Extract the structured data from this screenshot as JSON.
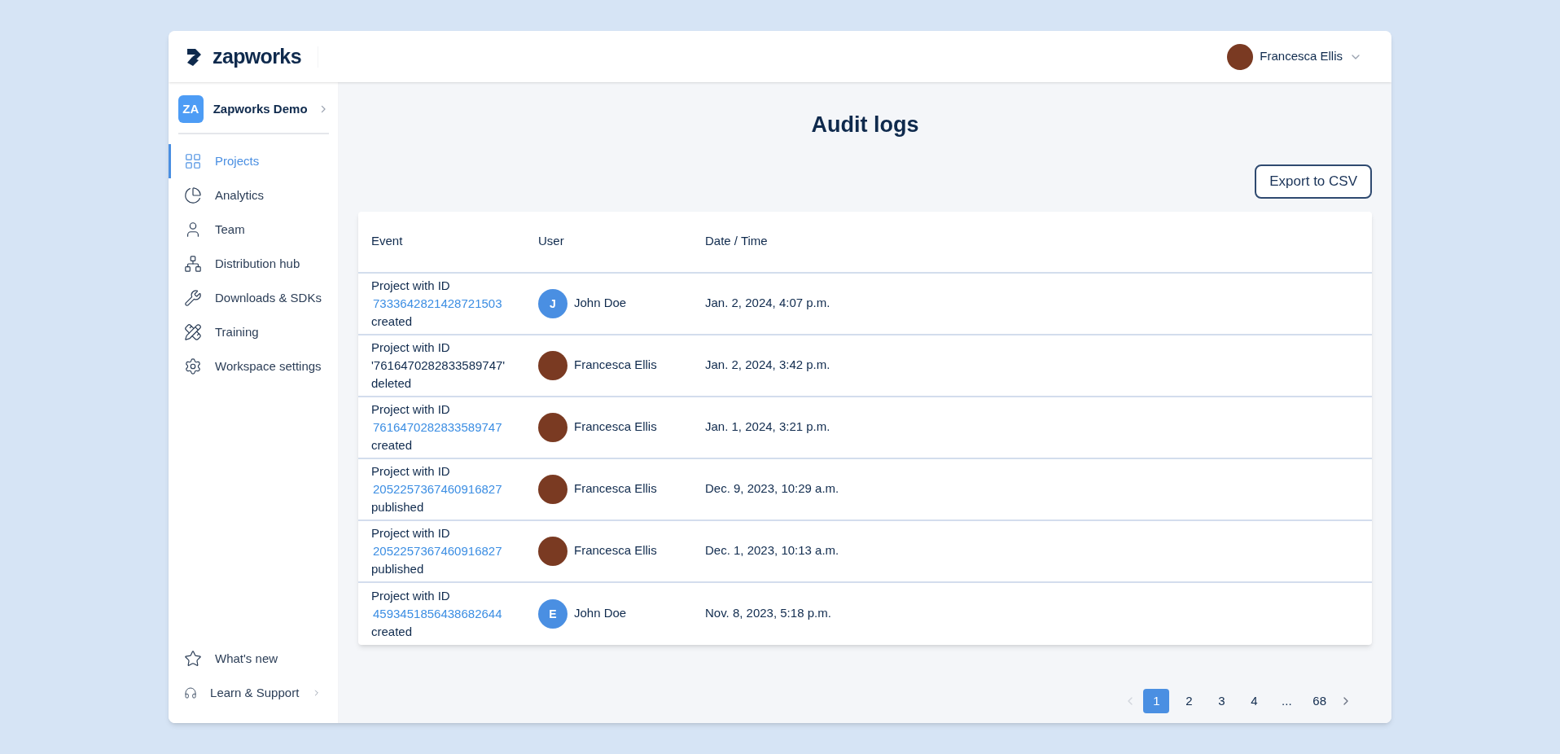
{
  "header": {
    "logo": "zapworks",
    "user": {
      "name": "Francesca Ellis"
    }
  },
  "workspace": {
    "initials": "ZA",
    "name": "Zapworks Demo"
  },
  "sidebar": {
    "items": [
      {
        "label": "Projects",
        "selected": true
      },
      {
        "label": "Analytics",
        "selected": false
      },
      {
        "label": "Team",
        "selected": false
      },
      {
        "label": "Distribution hub",
        "selected": false
      },
      {
        "label": "Downloads & SDKs",
        "selected": false
      },
      {
        "label": "Training",
        "selected": false
      },
      {
        "label": "Workspace settings",
        "selected": false
      }
    ],
    "footer_items": [
      {
        "label": "What's new",
        "has_arrow": false
      },
      {
        "label": "Learn & Support",
        "has_arrow": true
      }
    ]
  },
  "page": {
    "title": "Audit logs",
    "export_button": "Export to CSV"
  },
  "table": {
    "columns": [
      "Event",
      "User",
      "Date / Time"
    ],
    "rows": [
      {
        "event_prefix": "Project with ID",
        "project_id": "7333642821428721503",
        "kind": "link",
        "event_action": "created",
        "user": {
          "kind": "initial",
          "initial": "J",
          "name": "John Doe"
        },
        "datetime": "Jan. 2, 2024, 4:07 p.m."
      },
      {
        "event_prefix": "Project with ID",
        "project_id": "'7616470282833589747'",
        "kind": "plain",
        "event_action": "deleted",
        "user": {
          "kind": "photo",
          "name": "Francesca Ellis"
        },
        "datetime": "Jan. 2, 2024, 3:42 p.m."
      },
      {
        "event_prefix": "Project with ID",
        "project_id": "7616470282833589747",
        "kind": "link",
        "event_action": "created",
        "user": {
          "kind": "photo",
          "name": "Francesca Ellis"
        },
        "datetime": "Jan. 1, 2024, 3:21 p.m."
      },
      {
        "event_prefix": "Project with ID",
        "project_id": "2052257367460916827",
        "event_action": "published",
        "user": {
          "kind": "photo",
          "name": "Francesca Ellis"
        },
        "kind": "link",
        "datetime": "Dec. 9, 2023, 10:29 a.m."
      },
      {
        "event_prefix": "Project with ID",
        "project_id": "2052257367460916827",
        "event_action": "published",
        "user": {
          "kind": "photo",
          "name": "Francesca Ellis"
        },
        "kind": "link",
        "datetime": "Dec. 1, 2023, 10:13 a.m."
      },
      {
        "event_prefix": "Project with ID",
        "project_id": "4593451856438682644",
        "kind": "link",
        "event_action": "created",
        "user": {
          "kind": "initial",
          "initial": "E",
          "name": "John Doe"
        },
        "datetime": "Nov. 8, 2023, 5:18 p.m."
      }
    ]
  },
  "pagination": {
    "pages": [
      {
        "label": "1",
        "selected": true
      },
      {
        "label": "2",
        "selected": false
      },
      {
        "label": "3",
        "selected": false
      },
      {
        "label": "4",
        "selected": false
      },
      {
        "label": "...",
        "selected": false
      },
      {
        "label": "68",
        "selected": false
      }
    ]
  }
}
